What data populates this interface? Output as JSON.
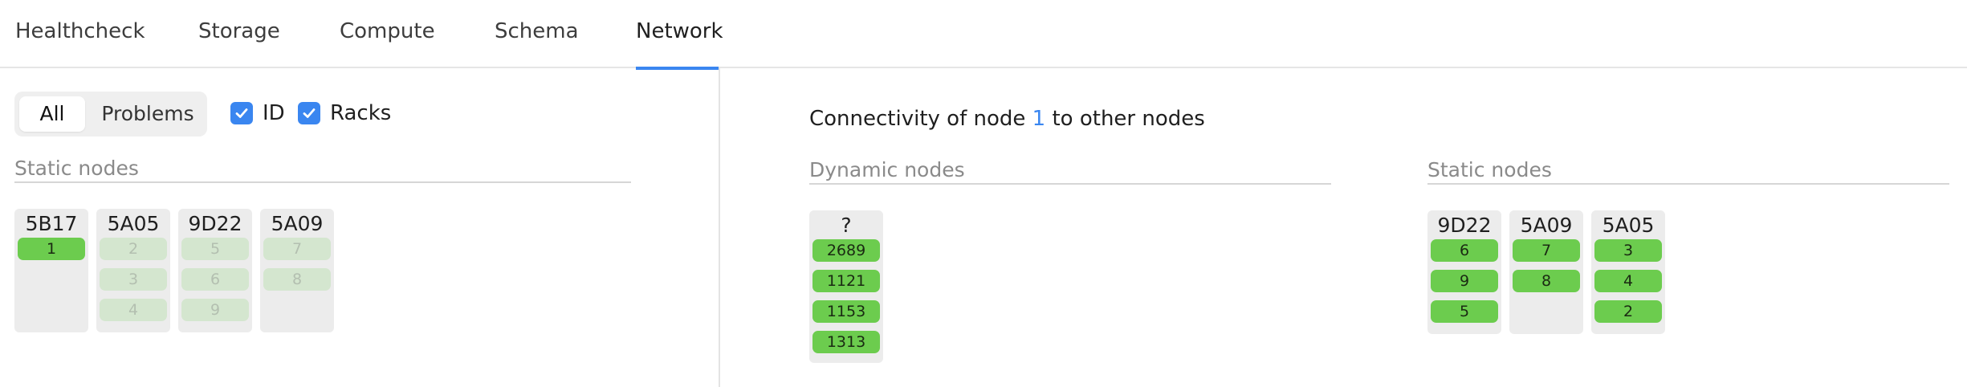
{
  "tabs": [
    {
      "label": "Healthcheck",
      "active": false
    },
    {
      "label": "Storage",
      "active": false
    },
    {
      "label": "Compute",
      "active": false
    },
    {
      "label": "Schema",
      "active": false
    },
    {
      "label": "Network",
      "active": true
    }
  ],
  "filter": {
    "all_label": "All",
    "problems_label": "Problems",
    "selected": "All"
  },
  "checkboxes": {
    "id": {
      "label": "ID",
      "checked": true
    },
    "racks": {
      "label": "Racks",
      "checked": true
    }
  },
  "left": {
    "section_title": "Static nodes",
    "racks": [
      {
        "name": "5B17",
        "nodes": [
          {
            "id": "1",
            "state": "ok"
          }
        ]
      },
      {
        "name": "5A05",
        "nodes": [
          {
            "id": "2",
            "state": "dim"
          },
          {
            "id": "3",
            "state": "dim"
          },
          {
            "id": "4",
            "state": "dim"
          }
        ]
      },
      {
        "name": "9D22",
        "nodes": [
          {
            "id": "5",
            "state": "dim"
          },
          {
            "id": "6",
            "state": "dim"
          },
          {
            "id": "9",
            "state": "dim"
          }
        ]
      },
      {
        "name": "5A09",
        "nodes": [
          {
            "id": "7",
            "state": "dim"
          },
          {
            "id": "8",
            "state": "dim"
          }
        ]
      }
    ]
  },
  "connectivity": {
    "prefix": "Connectivity of node ",
    "node_id": "1",
    "suffix": " to other nodes"
  },
  "dynamic": {
    "section_title": "Dynamic nodes",
    "racks": [
      {
        "name": "?",
        "nodes": [
          {
            "id": "2689",
            "state": "ok"
          },
          {
            "id": "1121",
            "state": "ok"
          },
          {
            "id": "1153",
            "state": "ok"
          },
          {
            "id": "1313",
            "state": "ok"
          }
        ]
      }
    ]
  },
  "static_right": {
    "section_title": "Static nodes",
    "racks": [
      {
        "name": "9D22",
        "nodes": [
          {
            "id": "6",
            "state": "ok"
          },
          {
            "id": "9",
            "state": "ok"
          },
          {
            "id": "5",
            "state": "ok"
          }
        ]
      },
      {
        "name": "5A09",
        "nodes": [
          {
            "id": "7",
            "state": "ok"
          },
          {
            "id": "8",
            "state": "ok"
          }
        ]
      },
      {
        "name": "5A05",
        "nodes": [
          {
            "id": "3",
            "state": "ok"
          },
          {
            "id": "4",
            "state": "ok"
          },
          {
            "id": "2",
            "state": "ok"
          }
        ]
      }
    ]
  },
  "colors": {
    "accent": "#3a86f0",
    "node_ok": "#6ccc4e",
    "node_dim": "#d4e6cf",
    "rack_bg": "#ececec"
  }
}
